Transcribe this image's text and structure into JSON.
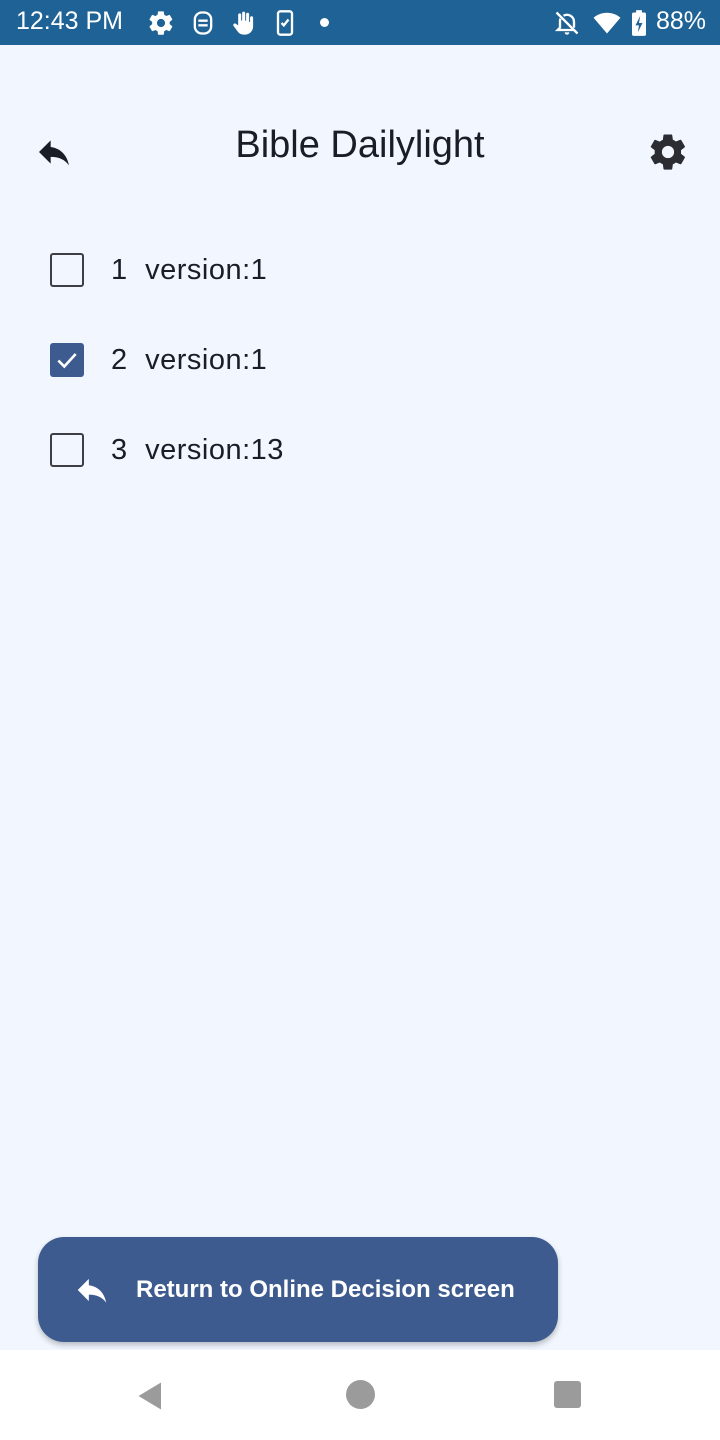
{
  "status_bar": {
    "time": "12:43 PM",
    "icons": [
      "gear-icon",
      "accessibility-icon",
      "hand-icon",
      "phone-check-icon",
      "dot-icon",
      "bell-off-icon",
      "wifi-icon",
      "battery-charging-icon"
    ],
    "battery": "88%"
  },
  "app_bar": {
    "title": "Bible Dailylight",
    "back_icon": "reply-arrow-icon",
    "settings_icon": "gear-icon"
  },
  "versions": [
    {
      "number": "1",
      "label": "version:1",
      "checked": false
    },
    {
      "number": "2",
      "label": "version:1",
      "checked": true
    },
    {
      "number": "3",
      "label": "version:13",
      "checked": false
    }
  ],
  "return_button": {
    "label": "Return to Online Decision screen",
    "icon": "reply-arrow-icon"
  },
  "nav_bar": {
    "icons": [
      "nav-back-icon",
      "nav-home-icon",
      "nav-recents-icon"
    ]
  },
  "colors": {
    "status_bar": "#1f6296",
    "background": "#f2f7ff",
    "accent": "#3e5b8f",
    "text": "#1b1d24"
  }
}
